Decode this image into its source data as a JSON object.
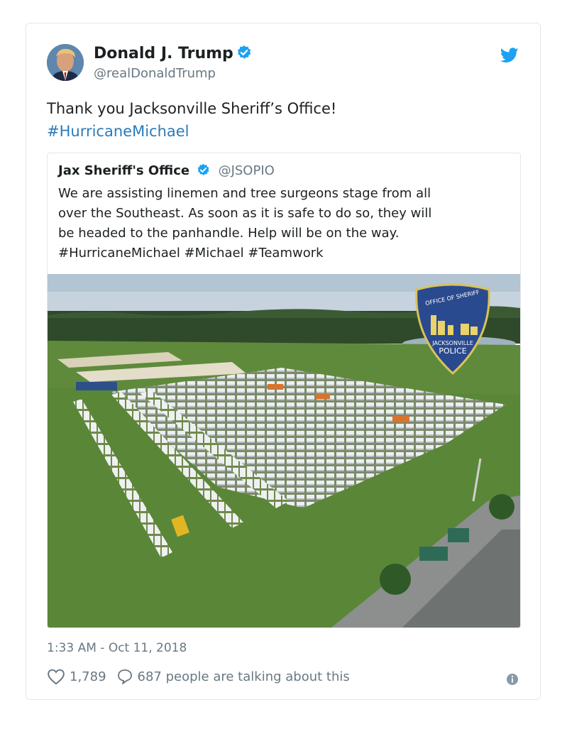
{
  "tweet": {
    "author_name": "Donald J. Trump",
    "author_handle": "@realDonaldTrump",
    "avatar_icon": "avatar-photo",
    "verified_icon": "verified-badge-icon",
    "platform_icon": "twitter-bird-icon",
    "text_line1": "Thank you Jacksonville Sheriff’s Office!",
    "hashtag": "#HurricaneMichael",
    "timestamp": "1:33 AM - Oct 11, 2018",
    "likes": "1,789",
    "talking": "687 people are talking about this",
    "colors": {
      "accent": "#1da1f2",
      "link": "#2b7bb9",
      "secondary_text": "#697882",
      "border": "#e1e8ed"
    }
  },
  "quoted": {
    "author_name": "Jax Sheriff's Office",
    "author_handle": "@JSOPIO",
    "lines": [
      "We are assisting linemen and tree surgeons stage from all",
      "over the Southeast.  As soon as it is safe to do so, they will",
      "be headed to the panhandle.  Help will be on the way.",
      "#HurricaneMichael #Michael #Teamwork"
    ],
    "photo": {
      "badge_line1": "OFFICE OF SHERIFF",
      "badge_line2": "JACKSONVILLE",
      "badge_line3": "POLICE"
    }
  }
}
